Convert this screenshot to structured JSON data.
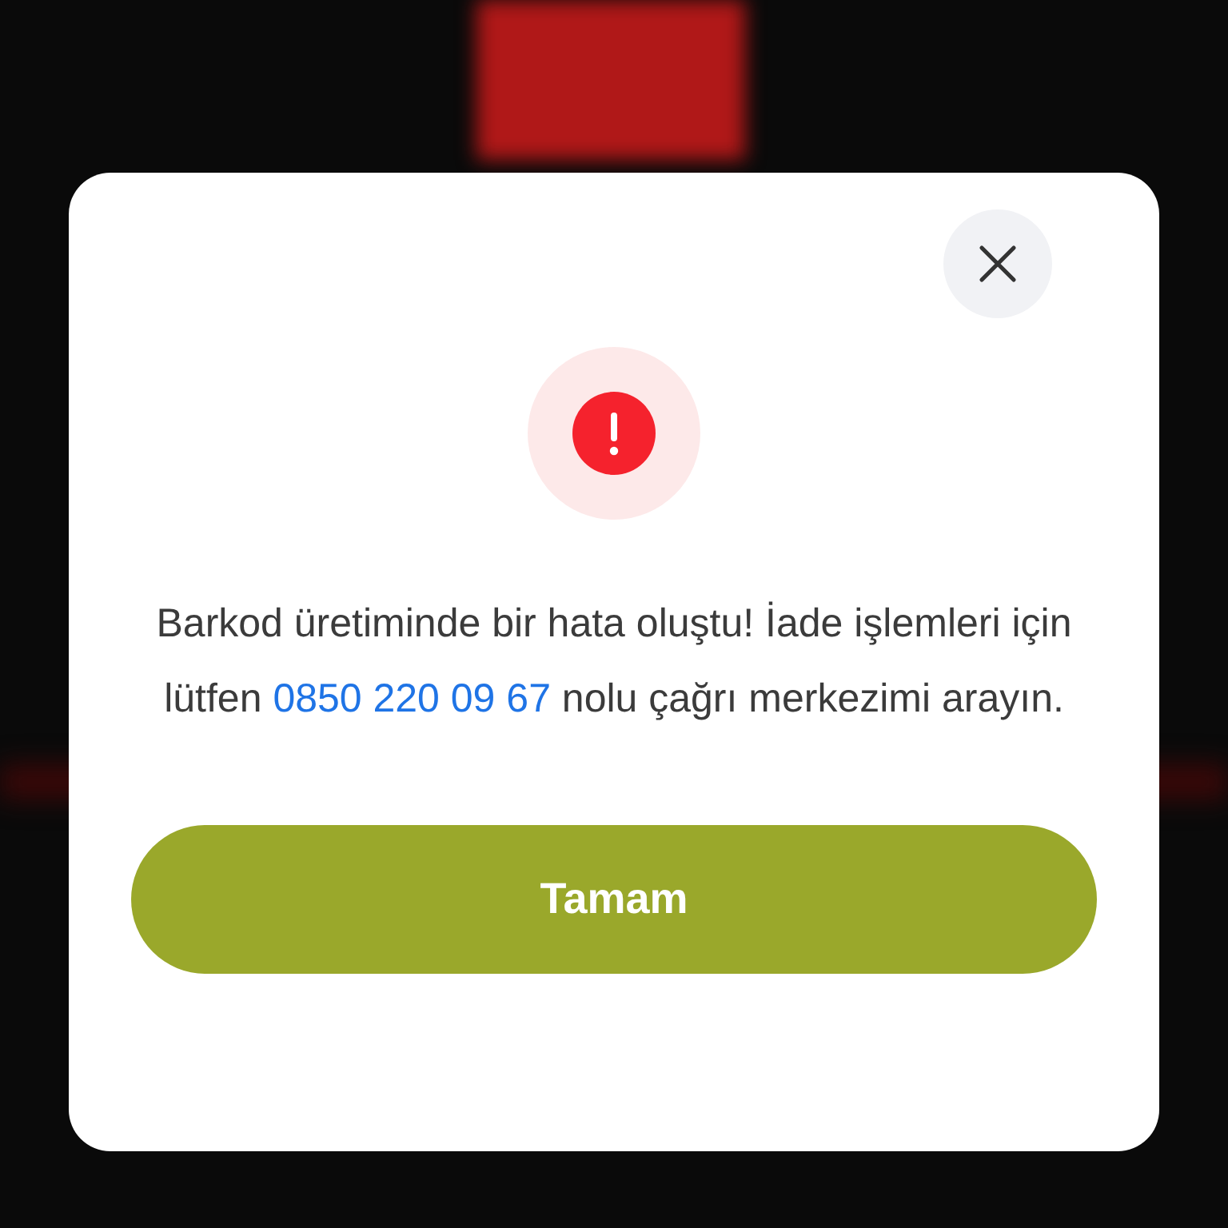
{
  "dialog": {
    "message_before": "Barkod üretiminde bir hata oluştu! İade işlemleri için lütfen",
    "phone": "0850 220 09 67",
    "message_after": "nolu çağrı merkezimi arayın.",
    "button": "Tamam"
  }
}
